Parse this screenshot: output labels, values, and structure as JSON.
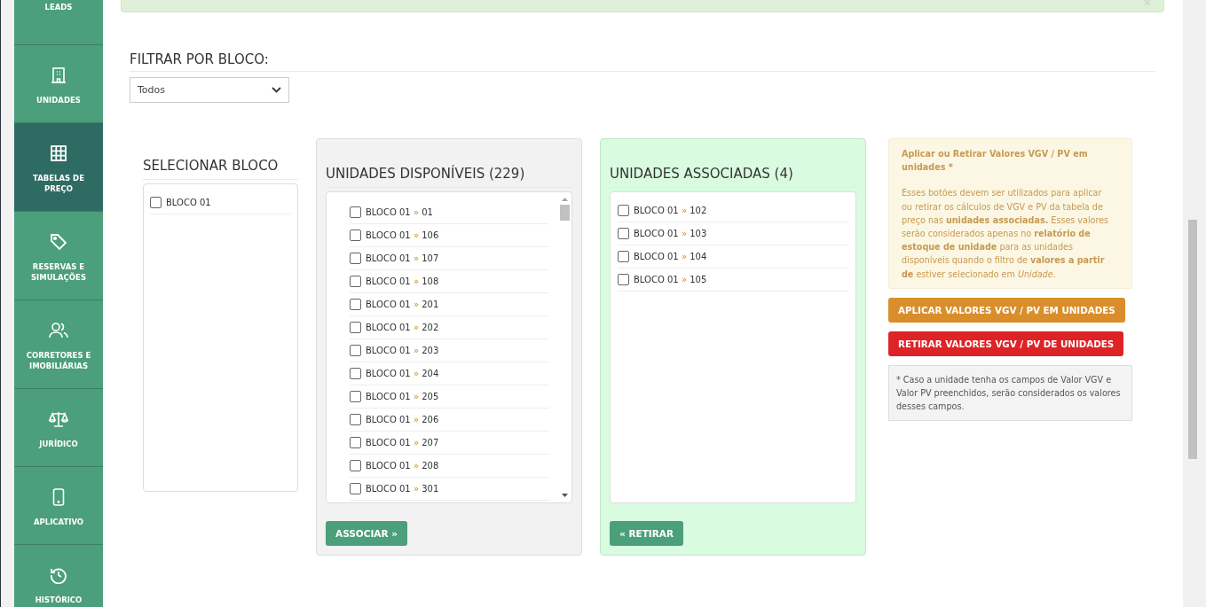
{
  "sidebar": {
    "items": [
      {
        "label": "LEADS",
        "selected": false
      },
      {
        "label": "UNIDADES",
        "selected": false
      },
      {
        "label": "TABELAS DE PREÇO",
        "selected": true
      },
      {
        "label": "RESERVAS E SIMULAÇÕES",
        "selected": false
      },
      {
        "label": "CORRETORES E IMOBILIÁRIAS",
        "selected": false
      },
      {
        "label": "JURÍDICO",
        "selected": false
      },
      {
        "label": "APLICATIVO",
        "selected": false
      },
      {
        "label": "HISTÓRICO",
        "selected": false
      }
    ]
  },
  "filter": {
    "title": "FILTRAR POR BLOCO:",
    "value": "Todos"
  },
  "blocks": {
    "title": "SELECIONAR BLOCO",
    "items": [
      {
        "label": "BLOCO 01",
        "checked": false
      }
    ]
  },
  "available": {
    "title": "UNIDADES DISPONÍVEIS (229)",
    "button": "ASSOCIAR »",
    "items": [
      {
        "block": "BLOCO 01",
        "sep": "»",
        "unit": "01",
        "checked": false
      },
      {
        "block": "BLOCO 01",
        "sep": "»",
        "unit": "106",
        "checked": false
      },
      {
        "block": "BLOCO 01",
        "sep": "»",
        "unit": "107",
        "checked": false
      },
      {
        "block": "BLOCO 01",
        "sep": "»",
        "unit": "108",
        "checked": false
      },
      {
        "block": "BLOCO 01",
        "sep": "»",
        "unit": "201",
        "checked": false
      },
      {
        "block": "BLOCO 01",
        "sep": "»",
        "unit": "202",
        "checked": false
      },
      {
        "block": "BLOCO 01",
        "sep": "»",
        "unit": "203",
        "checked": false
      },
      {
        "block": "BLOCO 01",
        "sep": "»",
        "unit": "204",
        "checked": false
      },
      {
        "block": "BLOCO 01",
        "sep": "»",
        "unit": "205",
        "checked": false
      },
      {
        "block": "BLOCO 01",
        "sep": "»",
        "unit": "206",
        "checked": false
      },
      {
        "block": "BLOCO 01",
        "sep": "»",
        "unit": "207",
        "checked": false
      },
      {
        "block": "BLOCO 01",
        "sep": "»",
        "unit": "208",
        "checked": false
      },
      {
        "block": "BLOCO 01",
        "sep": "»",
        "unit": "301",
        "checked": false
      }
    ]
  },
  "associated": {
    "title": "UNIDADES ASSOCIADAS (4)",
    "button": "« RETIRAR",
    "items": [
      {
        "block": "BLOCO 01",
        "sep": "»",
        "unit": "102",
        "checked": false
      },
      {
        "block": "BLOCO 01",
        "sep": "»",
        "unit": "103",
        "checked": false
      },
      {
        "block": "BLOCO 01",
        "sep": "»",
        "unit": "104",
        "checked": false
      },
      {
        "block": "BLOCO 01",
        "sep": "»",
        "unit": "105",
        "checked": false
      }
    ]
  },
  "info": {
    "title": "Aplicar ou Retirar Valores VGV / PV em unidades *",
    "text": "Esses botões devem ser utilizados para aplicar ou retirar os cálculos de VGV e PV da tabela de preço nas **unidades associadas.** Esses valores serão considerados apenas no **relatório de estoque de unidade** para as unidades disponíveis quando o filtro de **valores a partir de** estiver selecionado em *Unidade*.",
    "apply_button": "APLICAR VALORES VGV / PV EM UNIDADES",
    "remove_button": "RETIRAR VALORES VGV / PV DE UNIDADES",
    "note": "* Caso a unidade tenha os campos de Valor VGV e Valor PV preenchidos, serão considerados os valores desses campos."
  }
}
